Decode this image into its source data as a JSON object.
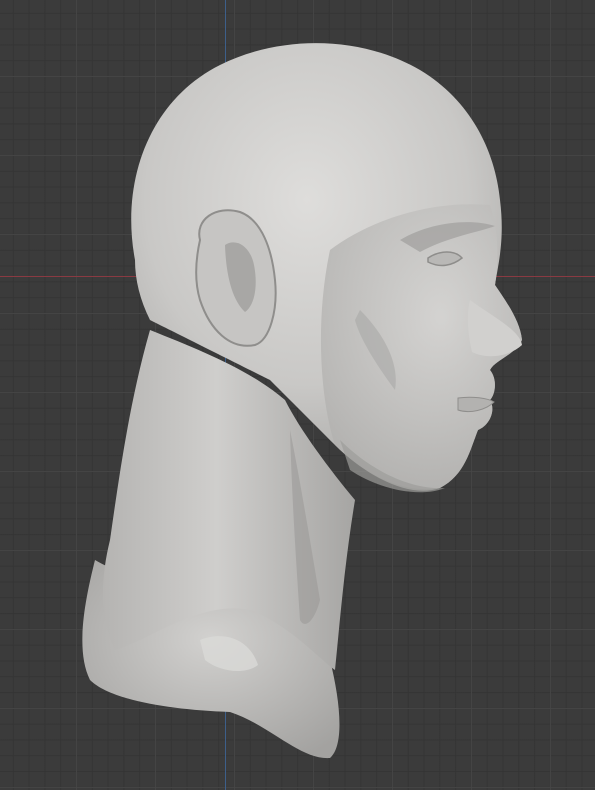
{
  "viewport": {
    "background_color": "#3b3b3b",
    "grid_color": "#464646",
    "x_axis_color": "#8a3a42",
    "y_axis_color": "#3d5f8a",
    "mesh_color": "#c4c4c2"
  },
  "model": {
    "icon": "sculpted-head-mesh"
  }
}
